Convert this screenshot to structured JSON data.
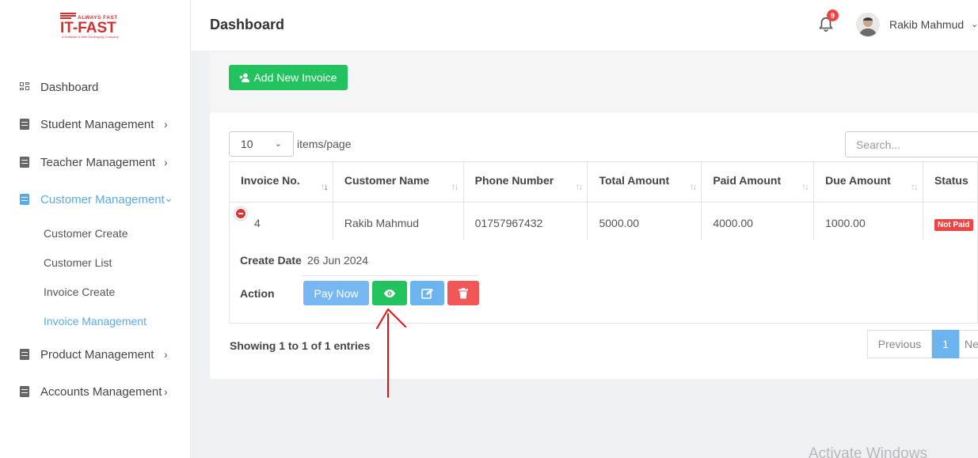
{
  "brand": {
    "tagline_top": "ALWAYS FAST",
    "name": "IT-FAST",
    "tagline_bottom": "A Software & Web Developing Company"
  },
  "header": {
    "title": "Dashboard",
    "notification_count": "9",
    "user_name": "Rakib Mahmud"
  },
  "sidebar": {
    "items": [
      {
        "label": "Dashboard",
        "icon": "dashboard-icon"
      },
      {
        "label": "Student Management",
        "icon": "document-icon",
        "chevron": "›"
      },
      {
        "label": "Teacher Management",
        "icon": "document-icon",
        "chevron": "›"
      },
      {
        "label": "Customer Management",
        "icon": "document-icon",
        "chevron": "⌄"
      },
      {
        "label": "Product Management",
        "icon": "document-icon",
        "chevron": "›"
      },
      {
        "label": "Accounts Management",
        "icon": "document-icon",
        "chevron": "›"
      }
    ],
    "sub_items": [
      "Customer Create",
      "Customer List",
      "Invoice Create",
      "Invoice Management"
    ]
  },
  "toolbar": {
    "add_label": "Add New Invoice"
  },
  "table_controls": {
    "page_size": "10",
    "items_per_page": "items/page",
    "search_placeholder": "Search..."
  },
  "table": {
    "headers": [
      "Invoice No.",
      "Customer Name",
      "Phone Number",
      "Total Amount",
      "Paid Amount",
      "Due Amount",
      "Status"
    ],
    "rows": [
      {
        "invoice_no": "4",
        "customer_name": "Rakib Mahmud",
        "phone": "01757967432",
        "total": "5000.00",
        "paid": "4000.00",
        "due": "1000.00",
        "status": "Not Paid"
      }
    ]
  },
  "details": {
    "create_date_label": "Create Date",
    "create_date_value": "26 Jun 2024",
    "action_label": "Action",
    "pay_now_label": "Pay Now"
  },
  "footer": {
    "showing": "Showing 1 to 1 of 1 entries",
    "previous": "Previous",
    "current_page": "1",
    "next": "Next"
  },
  "watermark": "Activate Windows",
  "colors": {
    "primary_green": "#22c35e",
    "accent_blue": "#5aa9e6",
    "danger_red": "#ef4444"
  }
}
